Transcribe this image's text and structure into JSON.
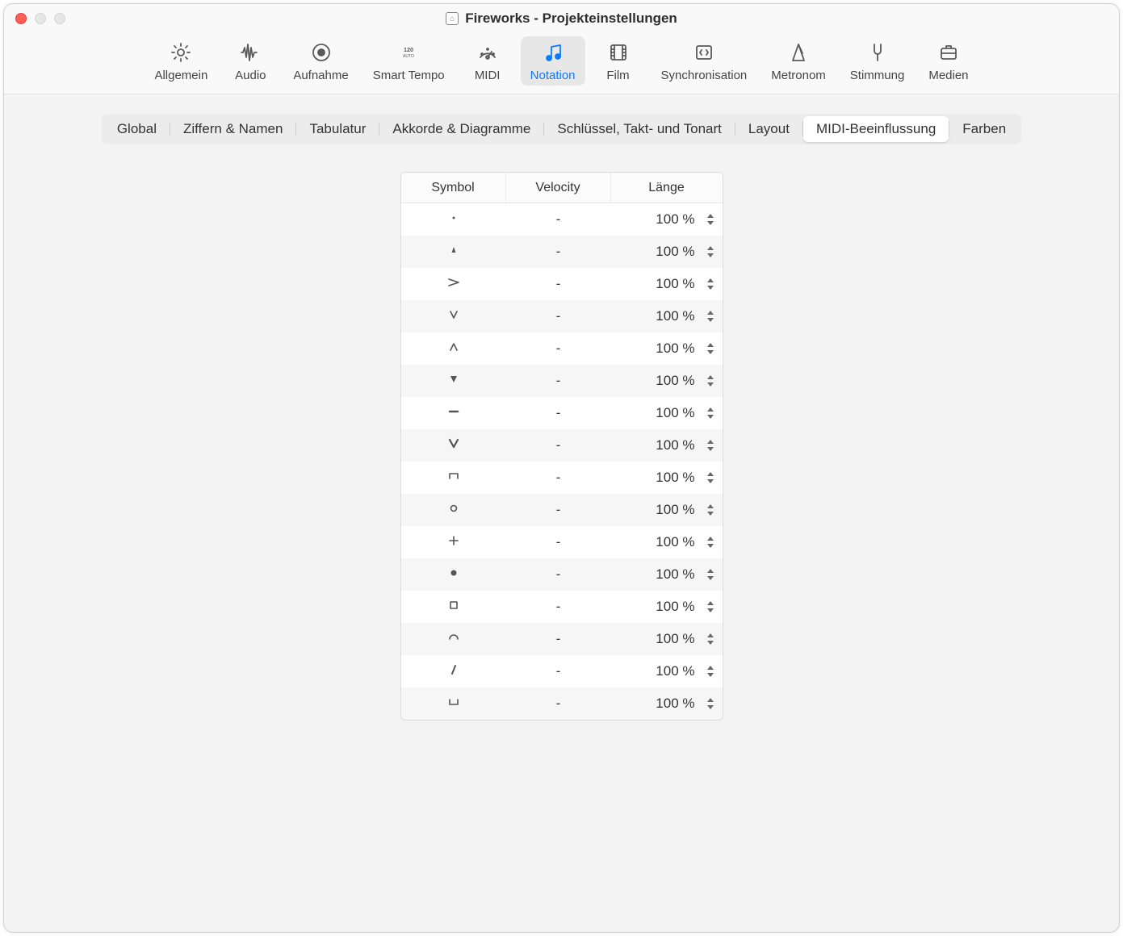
{
  "window": {
    "title": "Fireworks - Projekteinstellungen"
  },
  "toolbar": [
    {
      "id": "general",
      "label": "Allgemein",
      "icon": "gear",
      "active": false
    },
    {
      "id": "audio",
      "label": "Audio",
      "icon": "waveform",
      "active": false
    },
    {
      "id": "recording",
      "label": "Aufnahme",
      "icon": "record",
      "active": false
    },
    {
      "id": "smarttempo",
      "label": "Smart Tempo",
      "icon": "tempo120",
      "active": false
    },
    {
      "id": "midi",
      "label": "MIDI",
      "icon": "gauge",
      "active": false
    },
    {
      "id": "notation",
      "label": "Notation",
      "icon": "notes",
      "active": true
    },
    {
      "id": "film",
      "label": "Film",
      "icon": "film",
      "active": false
    },
    {
      "id": "sync",
      "label": "Synchronisation",
      "icon": "sync",
      "active": false
    },
    {
      "id": "metronome",
      "label": "Metronom",
      "icon": "metronome",
      "active": false
    },
    {
      "id": "tuning",
      "label": "Stimmung",
      "icon": "tuningfork",
      "active": false
    },
    {
      "id": "assets",
      "label": "Medien",
      "icon": "briefcase",
      "active": false
    }
  ],
  "subtabs": [
    {
      "id": "global",
      "label": "Global",
      "active": false
    },
    {
      "id": "ziffern",
      "label": "Ziffern & Namen",
      "active": false
    },
    {
      "id": "tabulatur",
      "label": "Tabulatur",
      "active": false
    },
    {
      "id": "akkorde",
      "label": "Akkorde & Diagramme",
      "active": false
    },
    {
      "id": "schluessel",
      "label": "Schlüssel, Takt- und Tonart",
      "active": false
    },
    {
      "id": "layout",
      "label": "Layout",
      "active": false
    },
    {
      "id": "midibeein",
      "label": "MIDI-Beeinflussung",
      "active": true
    },
    {
      "id": "farben",
      "label": "Farben",
      "active": false
    }
  ],
  "table": {
    "headers": {
      "symbol": "Symbol",
      "velocity": "Velocity",
      "length": "Länge"
    },
    "rows": [
      {
        "symbol": "dot-small",
        "velocity": "-",
        "length": "100 %"
      },
      {
        "symbol": "wedge-down-sm",
        "velocity": "-",
        "length": "100 %"
      },
      {
        "symbol": "accent",
        "velocity": "-",
        "length": "100 %"
      },
      {
        "symbol": "v-down",
        "velocity": "-",
        "length": "100 %"
      },
      {
        "symbol": "v-up",
        "velocity": "-",
        "length": "100 %"
      },
      {
        "symbol": "tri-down",
        "velocity": "-",
        "length": "100 %"
      },
      {
        "symbol": "tenuto",
        "velocity": "-",
        "length": "100 %"
      },
      {
        "symbol": "v-down-bold",
        "velocity": "-",
        "length": "100 %"
      },
      {
        "symbol": "bracket-down",
        "velocity": "-",
        "length": "100 %"
      },
      {
        "symbol": "circle-open",
        "velocity": "-",
        "length": "100 %"
      },
      {
        "symbol": "plus",
        "velocity": "-",
        "length": "100 %"
      },
      {
        "symbol": "dot-filled",
        "velocity": "-",
        "length": "100 %"
      },
      {
        "symbol": "square-open",
        "velocity": "-",
        "length": "100 %"
      },
      {
        "symbol": "fermata-arc",
        "velocity": "-",
        "length": "100 %"
      },
      {
        "symbol": "slash",
        "velocity": "-",
        "length": "100 %"
      },
      {
        "symbol": "bracket-up",
        "velocity": "-",
        "length": "100 %"
      }
    ]
  }
}
